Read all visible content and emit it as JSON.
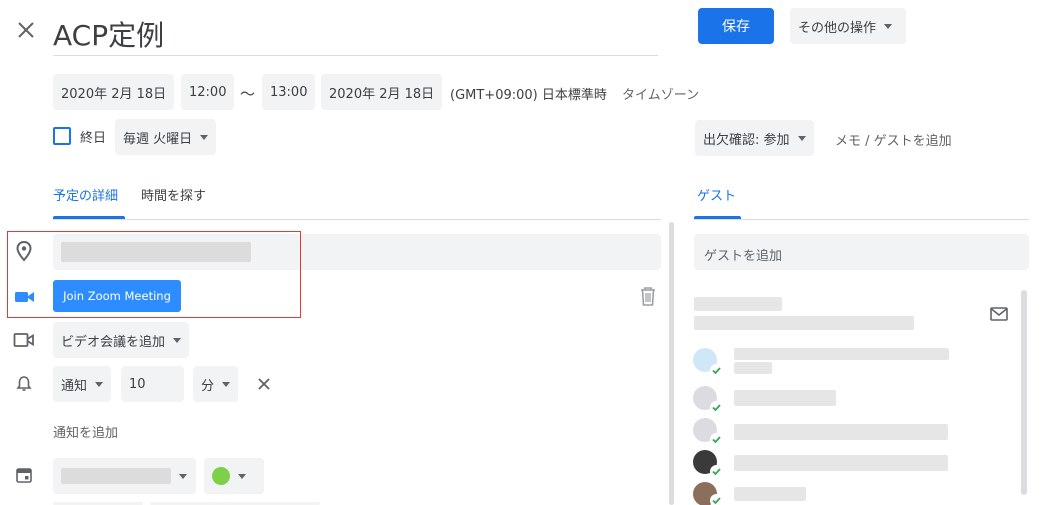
{
  "header": {
    "title": "ACP定例",
    "save_label": "保存",
    "more_actions_label": "その他の操作"
  },
  "datetime": {
    "start_date": "2020年 2月 18日",
    "start_time": "12:00",
    "separator": "〜",
    "end_time": "13:00",
    "end_date": "2020年 2月 18日",
    "timezone_value": "(GMT+09:00) 日本標準時",
    "timezone_link": "タイムゾーン",
    "all_day_label": "終日",
    "recurrence": "毎週 火曜日"
  },
  "rsvp": {
    "label": "出欠確認: 参加",
    "note_link": "メモ / ゲストを追加"
  },
  "tabs": {
    "details": "予定の詳細",
    "find_time": "時間を探す"
  },
  "details": {
    "zoom_button": "Join Zoom Meeting",
    "video_conf": "ビデオ会議を追加",
    "notification_type": "通知",
    "notification_value": "10",
    "notification_unit": "分",
    "add_notification": "通知を追加"
  },
  "guests": {
    "tab_label": "ゲスト",
    "add_placeholder": "ゲストを追加"
  },
  "colors": {
    "accent": "#1a73e8",
    "event_color": "#7cd147",
    "highlight_box": "#e53935",
    "zoom_button": "#2d8cff",
    "check": "#34a853"
  }
}
